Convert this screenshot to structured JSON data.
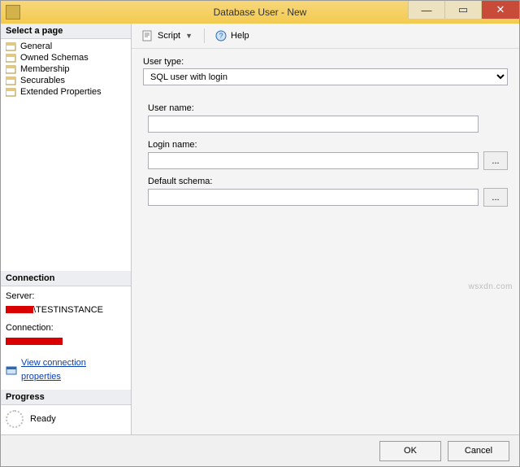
{
  "window": {
    "title": "Database User - New"
  },
  "titlebar_buttons": {
    "minimize": "—",
    "maximize": "▭",
    "close": "✕"
  },
  "sidebar": {
    "select_page_header": "Select a page",
    "pages": [
      {
        "label": "General"
      },
      {
        "label": "Owned Schemas"
      },
      {
        "label": "Membership"
      },
      {
        "label": "Securables"
      },
      {
        "label": "Extended Properties"
      }
    ],
    "connection_header": "Connection",
    "server_label": "Server:",
    "server_value_suffix": "\\TESTINSTANCE",
    "connection_label": "Connection:",
    "view_props_link": "View connection properties",
    "progress_header": "Progress",
    "progress_status": "Ready"
  },
  "toolbar": {
    "script_label": "Script",
    "help_label": "Help"
  },
  "form": {
    "user_type_label": "User type:",
    "user_type_value": "SQL user with login",
    "user_name_label": "User name:",
    "user_name_value": "",
    "login_name_label": "Login name:",
    "login_name_value": "",
    "default_schema_label": "Default schema:",
    "default_schema_value": "",
    "browse_label": "..."
  },
  "footer": {
    "ok": "OK",
    "cancel": "Cancel"
  },
  "watermark": "wsxdn.com"
}
